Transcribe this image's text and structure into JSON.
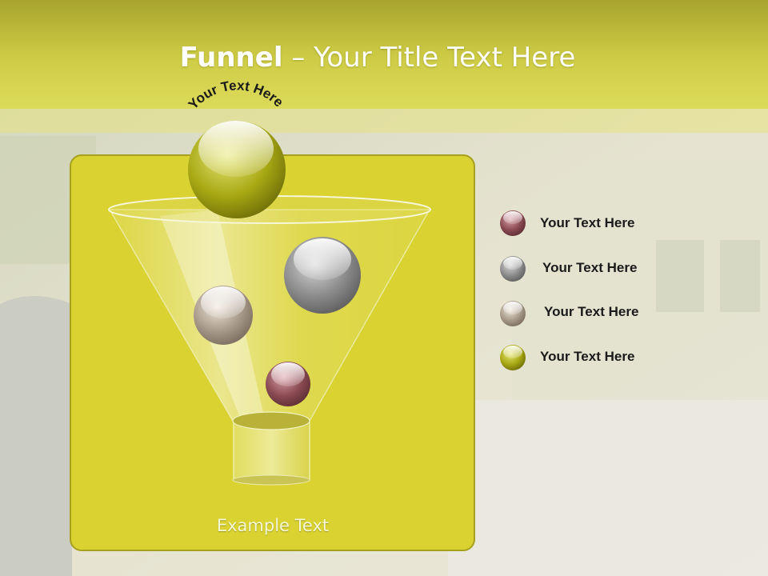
{
  "slide": {
    "title_bold": "Funnel",
    "title_rest": " – Your Title Text Here",
    "arc_label": "Your Text Here",
    "example_text": "Example Text"
  },
  "legend": [
    {
      "label": "Your  Text Here",
      "color": "#8a4a52"
    },
    {
      "label": "Your  Text Here",
      "color": "#8c8c8c"
    },
    {
      "label": "Your  Text Here",
      "color": "#a89a8a"
    },
    {
      "label": "Your  Text Here",
      "color": "#a8a814"
    }
  ],
  "colors": {
    "header": "#c8c83a",
    "panel": "#d9d230",
    "panel_border": "#a6a01e",
    "background": "#e8e6d4"
  }
}
